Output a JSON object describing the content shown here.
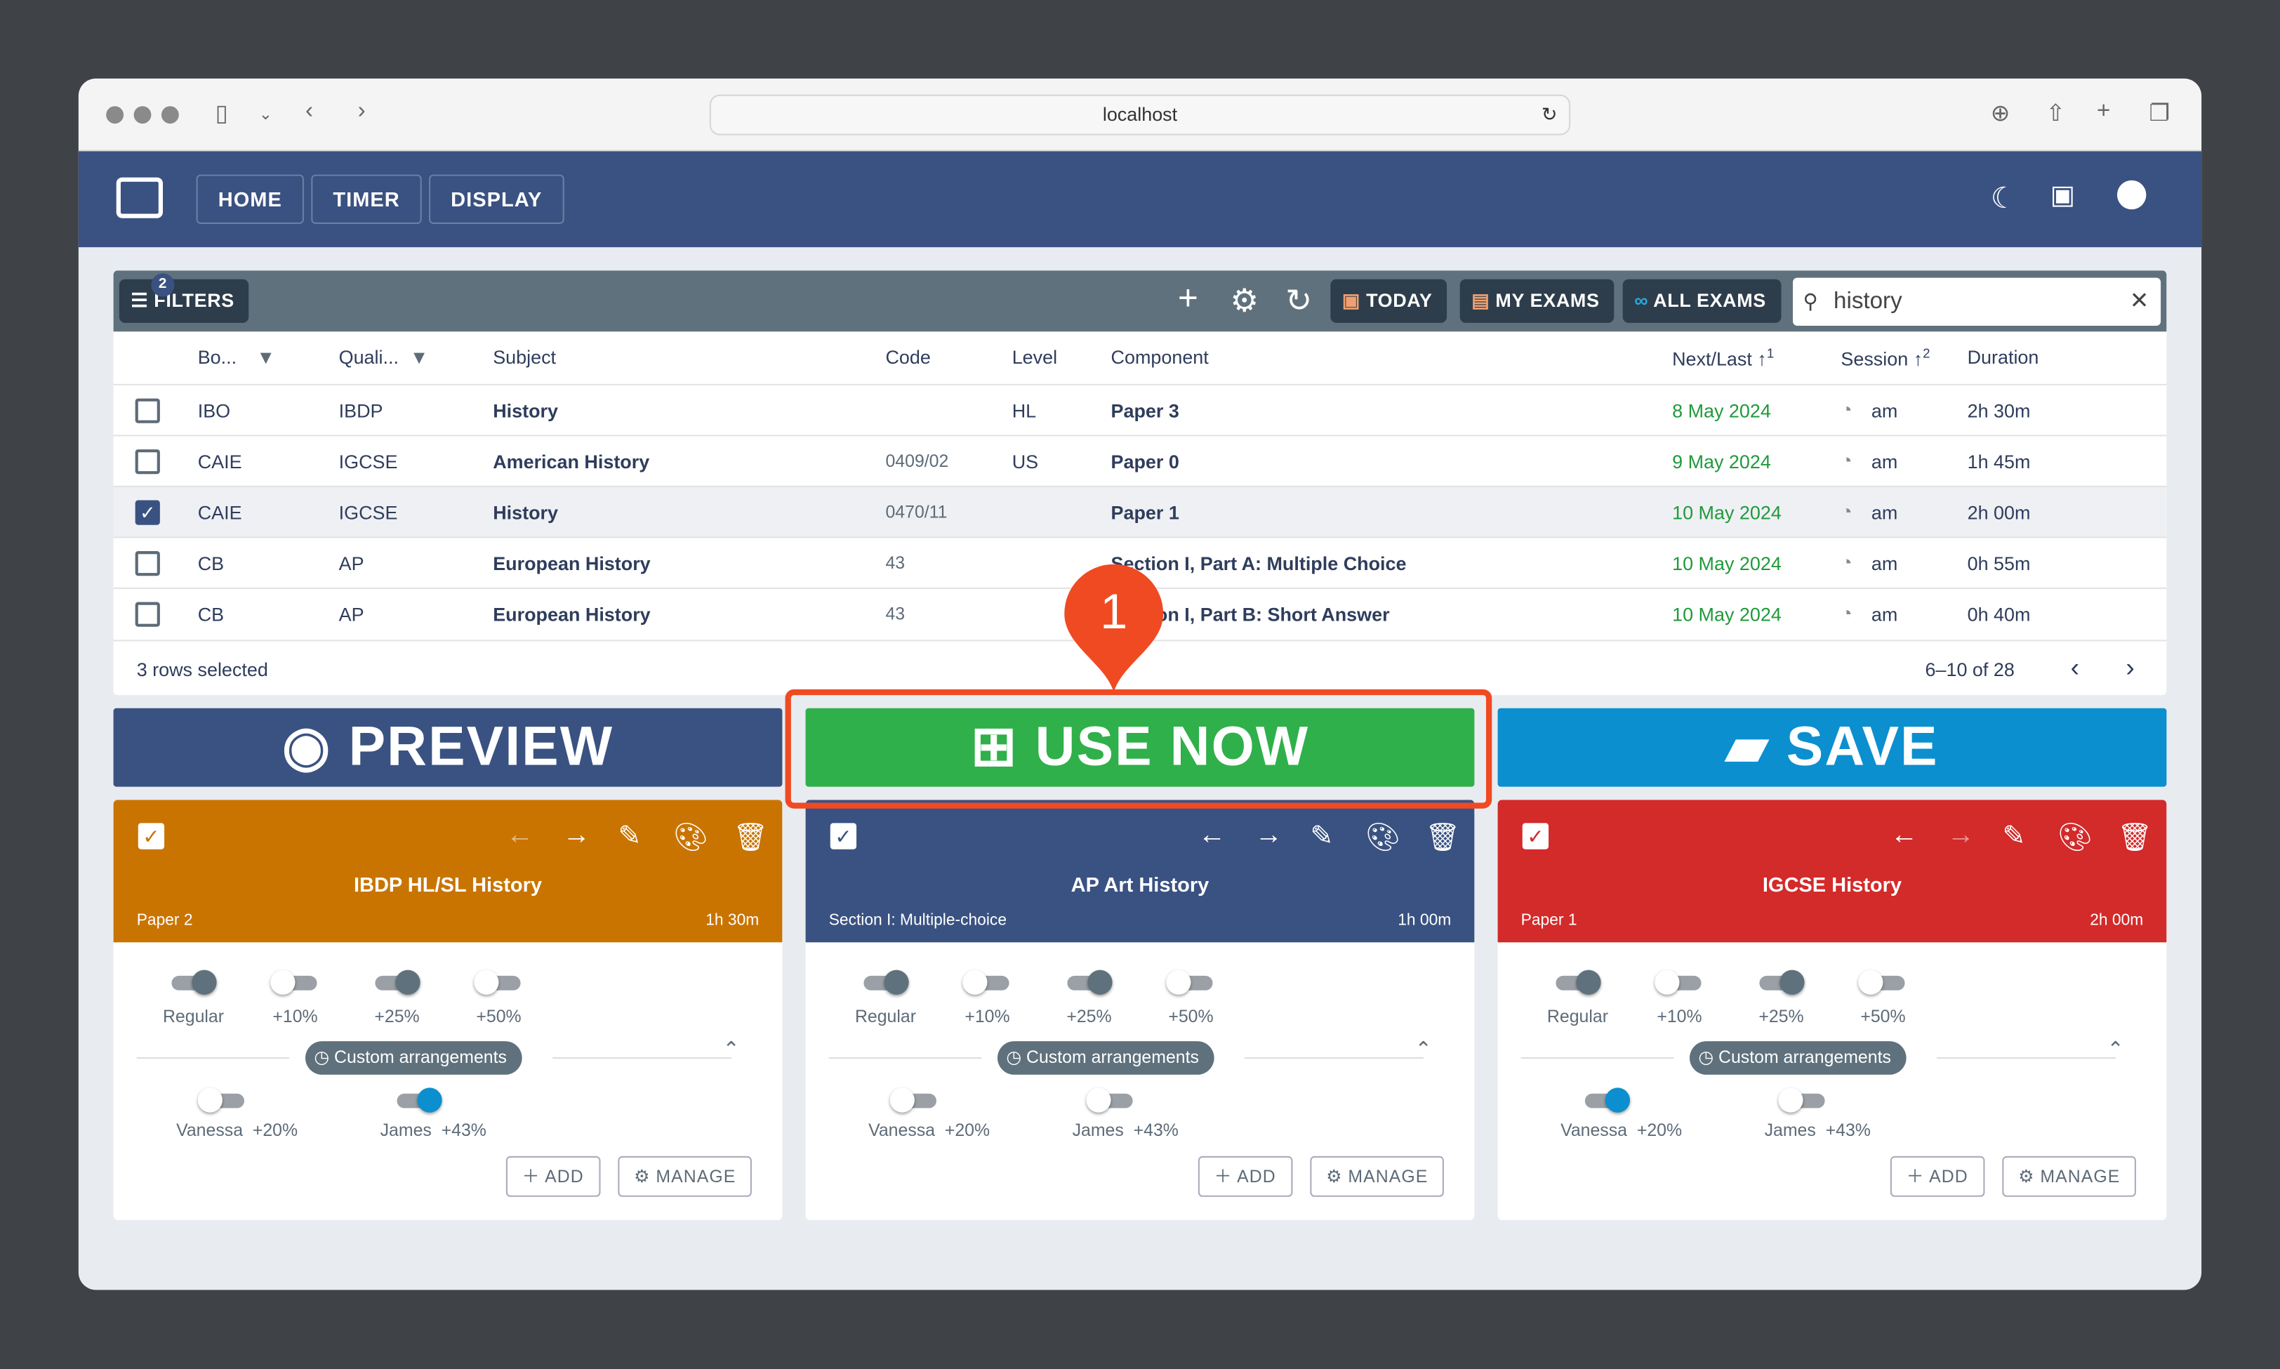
{
  "browser": {
    "url": "localhost"
  },
  "nav": {
    "items": [
      "HOME",
      "TIMER",
      "DISPLAY"
    ]
  },
  "toolbar": {
    "filters_label": "FILTERS",
    "filters_count": "2",
    "today": "TODAY",
    "my_exams": "MY EXAMS",
    "all_exams": "ALL EXAMS",
    "search_value": "history"
  },
  "table": {
    "headers": {
      "board": "Bo...",
      "qualification": "Quali...",
      "subject": "Subject",
      "code": "Code",
      "level": "Level",
      "component": "Component",
      "next_last": "Next/Last",
      "next_last_sort": "1",
      "session": "Session",
      "session_sort": "2",
      "duration": "Duration"
    },
    "rows": [
      {
        "checked": false,
        "board": "IBO",
        "qual": "IBDP",
        "subject": "History",
        "code": "",
        "level": "HL",
        "component": "Paper 3",
        "date": "8 May 2024",
        "session": "am",
        "duration": "2h 30m"
      },
      {
        "checked": false,
        "board": "CAIE",
        "qual": "IGCSE",
        "subject": "American History",
        "code": "0409/02",
        "level": "US",
        "component": "Paper 0",
        "date": "9 May 2024",
        "session": "am",
        "duration": "1h 45m"
      },
      {
        "checked": true,
        "board": "CAIE",
        "qual": "IGCSE",
        "subject": "History",
        "code": "0470/11",
        "level": "",
        "component": "Paper 1",
        "date": "10 May 2024",
        "session": "am",
        "duration": "2h 00m"
      },
      {
        "checked": false,
        "board": "CB",
        "qual": "AP",
        "subject": "European History",
        "code": "43",
        "level": "",
        "component": "Section I, Part A: Multiple Choice",
        "date": "10 May 2024",
        "session": "am",
        "duration": "0h 55m"
      },
      {
        "checked": false,
        "board": "CB",
        "qual": "AP",
        "subject": "European History",
        "code": "43",
        "level": "",
        "component": "Section I, Part B: Short Answer",
        "date": "10 May 2024",
        "session": "am",
        "duration": "0h 40m"
      }
    ],
    "selected_text": "3 rows selected",
    "pagination": "6–10 of 28"
  },
  "actions": {
    "preview": "PREVIEW",
    "use_now": "USE NOW",
    "save": "SAVE"
  },
  "marker": "1",
  "cards": [
    {
      "title": "IBDP HL/SL History",
      "component": "Paper 2",
      "duration": "1h 30m",
      "color": "#c97400",
      "toggles": [
        true,
        false,
        true,
        false
      ],
      "arr": [
        {
          "name": "Vanessa",
          "pct": "+20%",
          "on": false
        },
        {
          "name": "James",
          "pct": "+43%",
          "on": true
        }
      ]
    },
    {
      "title": "AP Art History",
      "component": "Section I: Multiple-choice",
      "duration": "1h 00m",
      "color": "#3a5281",
      "toggles": [
        true,
        false,
        true,
        false
      ],
      "arr": [
        {
          "name": "Vanessa",
          "pct": "+20%",
          "on": false
        },
        {
          "name": "James",
          "pct": "+43%",
          "on": false
        }
      ]
    },
    {
      "title": "IGCSE History",
      "component": "Paper 1",
      "duration": "2h 00m",
      "color": "#d32a2a",
      "toggles": [
        true,
        false,
        true,
        false
      ],
      "arr": [
        {
          "name": "Vanessa",
          "pct": "+20%",
          "on": true
        },
        {
          "name": "James",
          "pct": "+43%",
          "on": false
        }
      ]
    }
  ],
  "card_labels": {
    "toggles": [
      "Regular",
      "+10%",
      "+25%",
      "+50%"
    ],
    "custom": "Custom arrangements",
    "add": "ADD",
    "manage": "MANAGE"
  }
}
